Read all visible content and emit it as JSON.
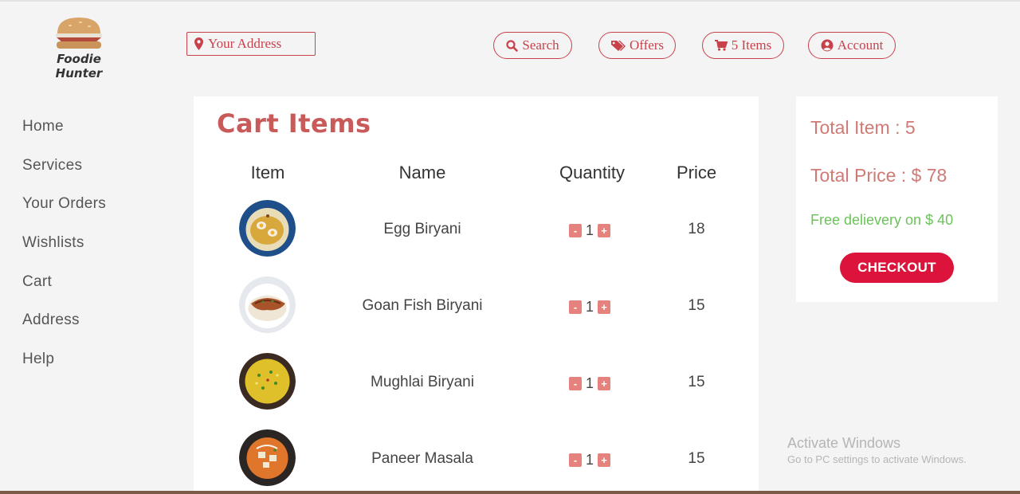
{
  "brand": {
    "name": "Foodie Hunter",
    "logo_icon": "sandwich-icon"
  },
  "header": {
    "address_placeholder": "Your Address",
    "nav": [
      {
        "label": "Search",
        "icon": "search-icon"
      },
      {
        "label": "Offers",
        "icon": "tags-icon"
      },
      {
        "label": "5 Items",
        "icon": "cart-icon"
      },
      {
        "label": "Account",
        "icon": "user-circle-icon"
      }
    ]
  },
  "sidebar": {
    "items": [
      {
        "label": "Home"
      },
      {
        "label": "Services"
      },
      {
        "label": "Your Orders"
      },
      {
        "label": "Wishlists"
      },
      {
        "label": "Cart"
      },
      {
        "label": "Address"
      },
      {
        "label": "Help"
      }
    ]
  },
  "cart": {
    "title": "Cart Items",
    "columns": [
      "Item",
      "Name",
      "Quantity",
      "Price"
    ],
    "rows": [
      {
        "name": "Egg Biryani",
        "quantity": "1",
        "price": "18"
      },
      {
        "name": "Goan Fish Biryani",
        "quantity": "1",
        "price": "15"
      },
      {
        "name": "Mughlai Biryani",
        "quantity": "1",
        "price": "15"
      },
      {
        "name": "Paneer Masala",
        "quantity": "1",
        "price": "15"
      }
    ],
    "minus_label": "-",
    "plus_label": "+"
  },
  "summary": {
    "total_items": "Total Item : 5",
    "total_price": "Total Price : $ 78",
    "free_delivery": "Free delievery on $ 40",
    "checkout_label": "CHECKOUT"
  },
  "watermark": {
    "title": "Activate Windows",
    "subtitle": "Go to PC settings to activate Windows."
  },
  "colors": {
    "accent": "#c8424c",
    "checkout": "#dc143c",
    "free_delivery": "#6cc35a",
    "title": "#c85a5a"
  }
}
